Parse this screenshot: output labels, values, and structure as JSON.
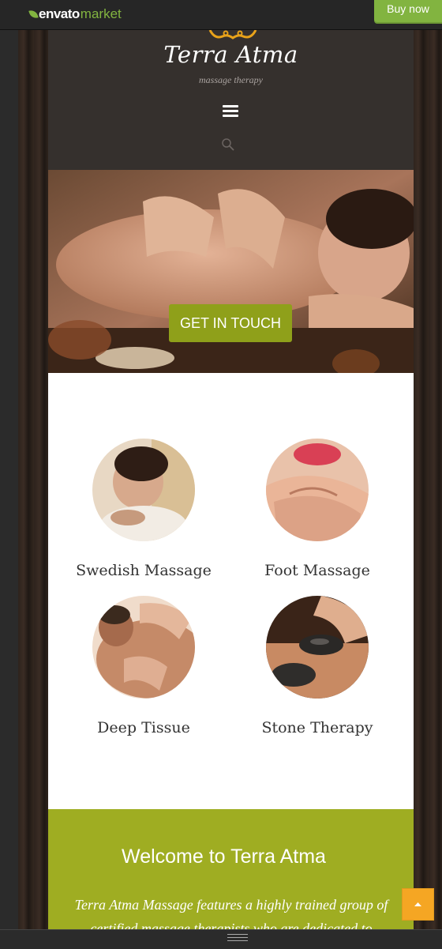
{
  "envato": {
    "brand": "envato",
    "market": "market",
    "buy_now": "Buy now"
  },
  "header": {
    "title": "Terra Atma",
    "tagline": "massage therapy"
  },
  "hero": {
    "cta_label": "GET IN TOUCH"
  },
  "services": [
    {
      "name": "Swedish Massage"
    },
    {
      "name": "Foot Massage"
    },
    {
      "name": "Deep Tissue"
    },
    {
      "name": "Stone Therapy"
    }
  ],
  "welcome": {
    "title": "Welcome to Terra Atma",
    "text": "Terra Atma Massage features a highly trained group of certified massage therapists who are dedicated to"
  },
  "colors": {
    "accent_green": "#8fa01a",
    "welcome_bg": "#9fad22",
    "envato_green": "#82b440",
    "scroll_top": "#f5a623"
  },
  "icons": {
    "menu": "hamburger-icon",
    "search": "search-icon",
    "scroll_top": "chevron-up-icon"
  }
}
